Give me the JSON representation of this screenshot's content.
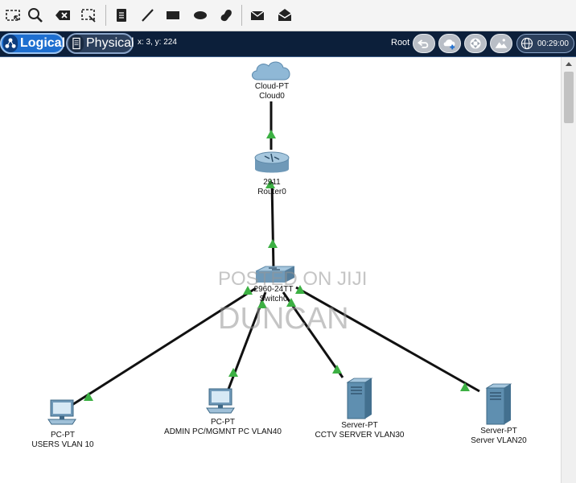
{
  "navbar": {
    "logical_label": "Logical",
    "physical_label": "Physical",
    "coords": "x: 3, y: 224",
    "root_label": "Root",
    "clock": "00:29:00"
  },
  "devices": {
    "cloud": {
      "model": "Cloud-PT",
      "name": "Cloud0"
    },
    "router": {
      "model": "2911",
      "name": "Router0"
    },
    "switch": {
      "model": "2960-24TT",
      "name": "Switch0"
    },
    "pc_users": {
      "model": "PC-PT",
      "name": "USERS VLAN 10"
    },
    "pc_admin": {
      "model": "PC-PT",
      "name": "ADMIN PC/MGMNT PC VLAN40"
    },
    "server_cctv": {
      "model": "Server-PT",
      "name": "CCTV SERVER VLAN30"
    },
    "server_vlan20": {
      "model": "Server-PT",
      "name": "Server VLAN20"
    }
  },
  "watermark": {
    "line1": "POSTED ON JIJI",
    "line2": "DUNCAN"
  },
  "colors": {
    "link_up": "#3cb043",
    "navbar": "#0c1f3a",
    "logical_active": "#1e6fd0"
  }
}
